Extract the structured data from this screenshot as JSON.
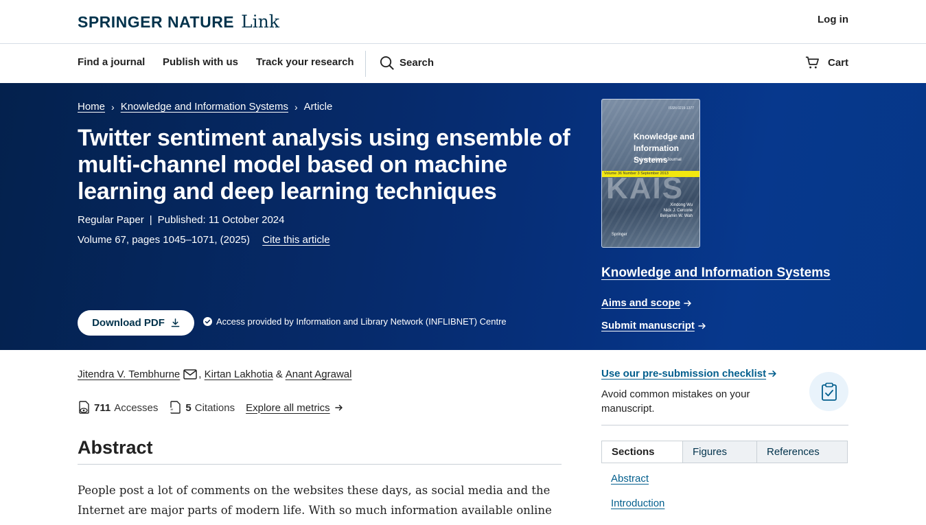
{
  "header": {
    "brand": "SPRINGER NATURE",
    "product": "Link",
    "login": "Log in"
  },
  "nav": {
    "items": [
      "Find a journal",
      "Publish with us",
      "Track your research"
    ],
    "search": "Search",
    "cart": "Cart"
  },
  "breadcrumb": [
    "Home",
    "Knowledge and Information Systems",
    "Article"
  ],
  "article": {
    "title": "Twitter sentiment analysis using ensemble of multi-channel model based on machine learning and deep learning techniques",
    "type": "Regular Paper",
    "published": "Published: 11 October 2024",
    "volume": "Volume 67, pages 1045–1071, (2025)",
    "cite": "Cite this article",
    "download": "Download PDF",
    "access": "Access provided by Information and Library Network (INFLIBNET) Centre"
  },
  "cover": {
    "issn": "ISSN 0219-1377",
    "title_line1": "Knowledge and",
    "title_line2": "Information Systems",
    "subtitle": "An International Journal",
    "issue": "Volume 36   Number 3   September 2013",
    "watermark": "KAIS",
    "editors": "Xindong Wu\nNick J. Cercone\nBenjamin W. Wah",
    "publisher": "Springer"
  },
  "journal": {
    "name": "Knowledge and Information Systems",
    "aims": "Aims and scope",
    "submit": "Submit manuscript"
  },
  "authors": {
    "a1": "Jitendra V. Tembhurne",
    "a2": "Kirtan Lakhotia",
    "a3": "Anant Agrawal",
    "amp": "&"
  },
  "metrics": {
    "accesses_count": "711",
    "accesses_label": "Accesses",
    "citations_count": "5",
    "citations_label": "Citations",
    "explore": "Explore all metrics"
  },
  "abstract": {
    "heading": "Abstract",
    "text": "People post a lot of comments on the websites these days, as social media and the Internet are major parts of modern life. With so much information available online related to"
  },
  "checklist": {
    "link": "Use our pre-submission checklist",
    "text": "Avoid common mistakes on your manuscript."
  },
  "tabs": [
    "Sections",
    "Figures",
    "References"
  ],
  "toc": [
    "Abstract",
    "Introduction"
  ]
}
